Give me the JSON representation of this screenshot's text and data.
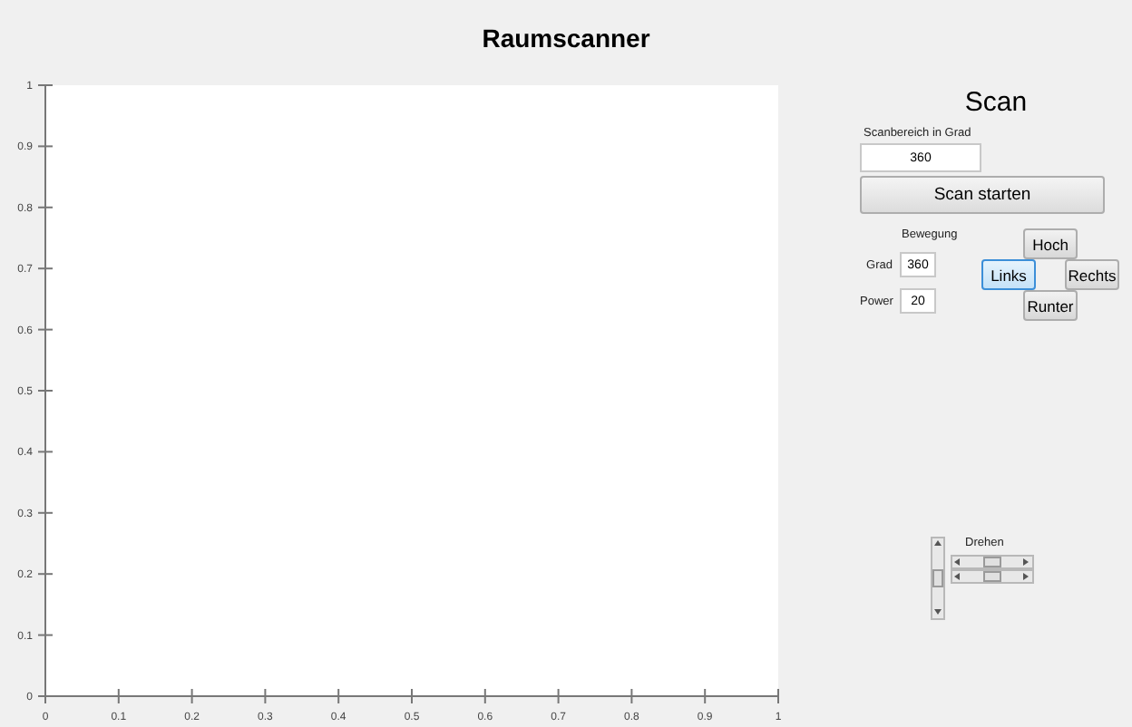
{
  "title": "Raumscanner",
  "chart": {
    "chart_data": {
      "type": "line",
      "xlim": [
        0,
        1
      ],
      "ylim": [
        0,
        1
      ],
      "xticks": [
        0,
        0.1,
        0.2,
        0.3,
        0.4,
        0.5,
        0.6,
        0.7,
        0.8,
        0.9,
        1
      ],
      "yticks": [
        0,
        0.1,
        0.2,
        0.3,
        0.4,
        0.5,
        0.6,
        0.7,
        0.8,
        0.9,
        1
      ]
    }
  },
  "scan": {
    "heading": "Scan",
    "range_label": "Scanbereich in Grad",
    "range_value": "360",
    "start_button": "Scan starten"
  },
  "movement": {
    "heading": "Bewegung",
    "fields": [
      {
        "label": "Grad",
        "value": "360"
      },
      {
        "label": "Power",
        "value": "20"
      }
    ]
  },
  "direction_buttons": [
    {
      "label": "Hoch",
      "selected": false
    },
    {
      "label": "Links",
      "selected": true
    },
    {
      "label": "Rechts",
      "selected": false
    },
    {
      "label": "Runter",
      "selected": false
    }
  ],
  "rotation": {
    "label": "Drehen",
    "vertical_slider": {
      "level": 0.5
    },
    "horizontal_sliders": [
      {
        "level": 0.5
      },
      {
        "level": 0.5
      }
    ]
  }
}
